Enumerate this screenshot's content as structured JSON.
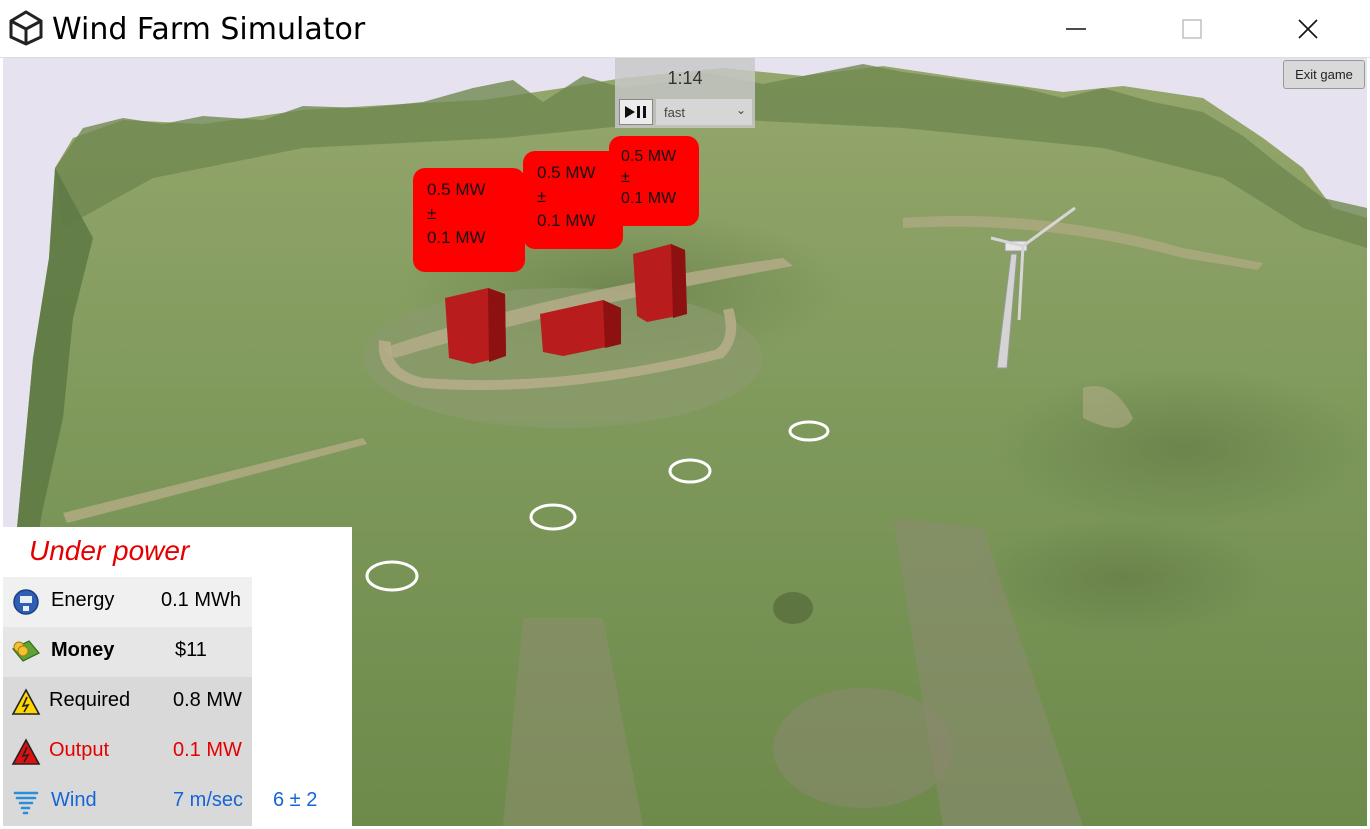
{
  "window": {
    "title": "Wind Farm Simulator",
    "icons": [
      "unity-logo-icon",
      "minimize-icon",
      "maximize-icon",
      "close-icon"
    ]
  },
  "controls": {
    "time": "1:14",
    "play_pause_icon": "play-pause-icon",
    "speed": "fast",
    "exit_label": "Exit game"
  },
  "demand_labels": [
    {
      "power": "0.5 MW",
      "pm": "±",
      "tolerance": "0.1 MW"
    },
    {
      "power": "0.5 MW",
      "pm": "±",
      "tolerance": "0.1 MW"
    },
    {
      "power": "0.5 MW",
      "pm": "±",
      "tolerance": "0.1 MW"
    }
  ],
  "stats": {
    "status": "Under power",
    "energy": {
      "label": "Energy",
      "value": "0.1 MWh",
      "icon": "meter-icon"
    },
    "money": {
      "label": "Money",
      "value": "$11",
      "icon": "money-icon"
    },
    "required": {
      "label": "Required",
      "value": "0.8 MW",
      "icon": "warning-icon"
    },
    "output": {
      "label": "Output",
      "value": "0.1 MW",
      "icon": "warning-red-icon"
    },
    "wind": {
      "label": "Wind",
      "value": "7 m/sec",
      "range": "6 ± 2",
      "icon": "tornado-icon"
    }
  },
  "colors": {
    "status_red": "#e40000",
    "wind_blue": "#1565d8",
    "label_red": "#ff0000",
    "terrain": "#7f9a5c"
  }
}
